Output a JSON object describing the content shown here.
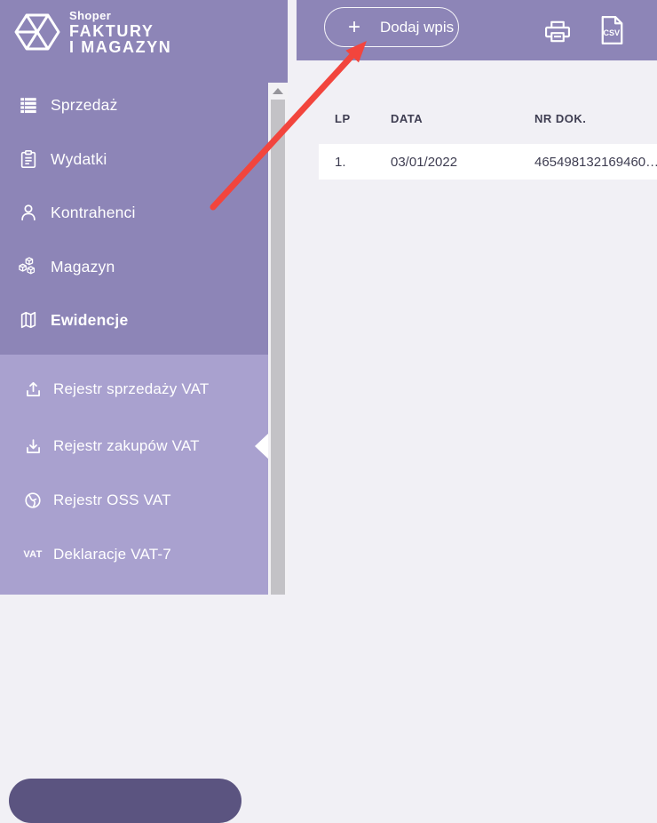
{
  "logo": {
    "brand": "Shoper",
    "line1": "FAKTURY",
    "line2": "I MAGAZYN"
  },
  "sidebar": {
    "items": [
      {
        "label": "Sprzedaż",
        "icon": "list-icon"
      },
      {
        "label": "Wydatki",
        "icon": "clipboard-icon"
      },
      {
        "label": "Kontrahenci",
        "icon": "person-icon"
      },
      {
        "label": "Magazyn",
        "icon": "cubes-icon"
      },
      {
        "label": "Ewidencje",
        "icon": "books-icon"
      }
    ],
    "submenu": [
      {
        "label": "Rejestr sprzedaży VAT",
        "icon": "upload-icon"
      },
      {
        "label": "Rejestr zakupów VAT",
        "icon": "download-icon",
        "selected": true
      },
      {
        "label": "Rejestr OSS VAT",
        "icon": "globe-icon"
      },
      {
        "label": "Deklaracje VAT-7",
        "icon": "vat-icon",
        "icon_text": "VAT"
      }
    ]
  },
  "toolbar": {
    "add_button": "Dodaj wpis",
    "plus": "+",
    "csv_label": "CSV"
  },
  "table": {
    "columns": [
      "LP",
      "DATA",
      "NR DOK."
    ],
    "rows": [
      {
        "lp": "1.",
        "data": "03/01/2022",
        "nr_dok": "465498132169460…"
      }
    ]
  },
  "colors": {
    "sidebar": "#8d85b7",
    "submenu": "#a9a1cf",
    "selected_item": "#5b5480",
    "topbar": "#8d85b7",
    "content_bg": "#f1f0f5",
    "text_dark": "#3e3d51",
    "arrow_red": "#f2453d"
  }
}
